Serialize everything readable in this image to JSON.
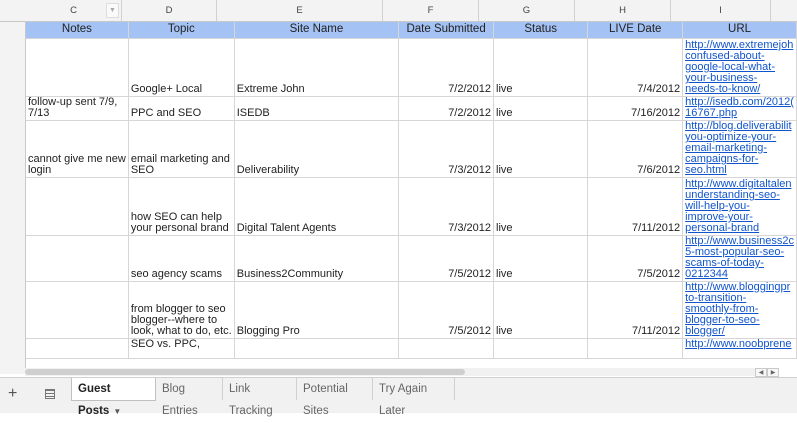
{
  "columns": [
    "C",
    "D",
    "E",
    "F",
    "G",
    "H",
    "I"
  ],
  "headers": [
    "Notes",
    "Topic",
    "Site Name",
    "Date Submitted",
    "Status",
    "LIVE Date",
    "URL"
  ],
  "rows": [
    {
      "notes": [],
      "topic": [
        "Google+ Local"
      ],
      "site": [
        "Extreme John"
      ],
      "date_submitted": "7/2/2012",
      "status": "live",
      "live_date": "7/4/2012",
      "url": [
        "http://www.extremejoh",
        "confused-about-",
        "google-local-what-",
        "your-business-",
        "needs-to-know/"
      ]
    },
    {
      "notes": [
        "follow-up sent 7/9,",
        "7/13"
      ],
      "topic": [
        "PPC and SEO"
      ],
      "site": [
        "ISEDB"
      ],
      "date_submitted": "7/2/2012",
      "status": "live",
      "live_date": "7/16/2012",
      "url": [
        "http://isedb.com/2012(",
        "16767.php"
      ]
    },
    {
      "notes": [
        "cannot give me new",
        "login"
      ],
      "topic": [
        "email marketing and",
        "SEO"
      ],
      "site": [
        "Deliverability"
      ],
      "date_submitted": "7/3/2012",
      "status": "live",
      "live_date": "7/6/2012",
      "url": [
        "http://blog.deliverabilit",
        "you-optimize-your-",
        "email-marketing-",
        "campaigns-for-",
        "seo.html"
      ]
    },
    {
      "notes": [],
      "topic": [
        "how SEO can help",
        "your personal brand"
      ],
      "site": [
        "Digital Talent Agents"
      ],
      "date_submitted": "7/3/2012",
      "status": "live",
      "live_date": "7/11/2012",
      "url": [
        "http://www.digitaltalen",
        "understanding-seo-",
        "will-help-you-",
        "improve-your-",
        "personal-brand"
      ]
    },
    {
      "notes": [],
      "topic": [
        "seo agency scams"
      ],
      "site": [
        "Business2Community"
      ],
      "date_submitted": "7/5/2012",
      "status": "live",
      "live_date": "7/5/2012",
      "url": [
        "http://www.business2c",
        "5-most-popular-seo-",
        "scams-of-today-",
        "0212344"
      ]
    },
    {
      "notes": [],
      "topic": [
        "from blogger to seo",
        "blogger--where to",
        "look, what to do, etc."
      ],
      "site": [
        "Blogging Pro"
      ],
      "date_submitted": "7/5/2012",
      "status": "live",
      "live_date": "7/11/2012",
      "url": [
        "http://www.bloggingpr",
        "to-transition-",
        "smoothly-from-",
        "blogger-to-seo-",
        "blogger/"
      ]
    },
    {
      "notes": [],
      "topic": [
        "SEO vs. PPC,"
      ],
      "site": [],
      "date_submitted": "",
      "status": "",
      "live_date": "",
      "url": [
        "http://www.noobprene"
      ]
    }
  ],
  "tabs": [
    {
      "label": "Guest Posts",
      "active": true
    },
    {
      "label": "Blog Entries",
      "active": false
    },
    {
      "label": "Link Tracking",
      "active": false
    },
    {
      "label": "Potential Sites",
      "active": false
    },
    {
      "label": "Try Again Later",
      "active": false
    }
  ],
  "icons": {
    "add_sheet": "plus-icon",
    "sheet_list": "list-icon",
    "dropdown": "caret-down-icon"
  }
}
